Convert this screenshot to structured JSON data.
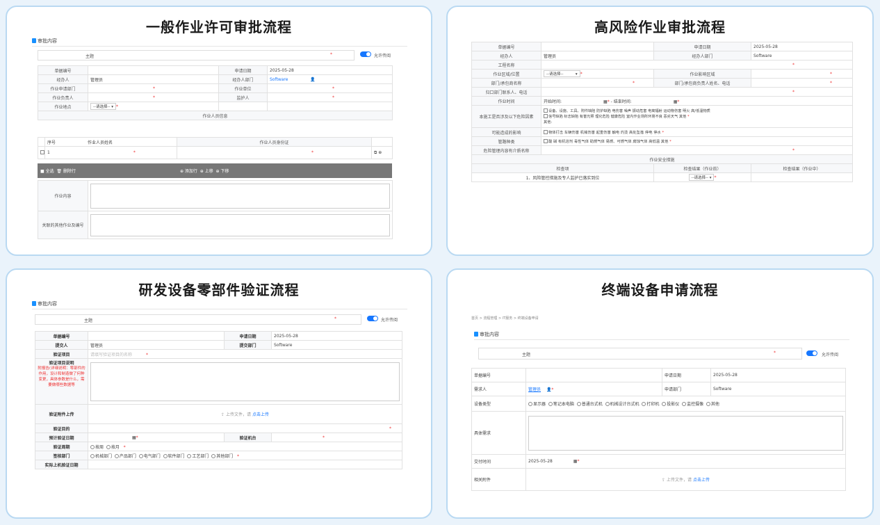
{
  "cards": [
    {
      "title": "一般作业许可审批流程"
    },
    {
      "title": "高风险作业审批流程"
    },
    {
      "title": "研发设备零部件验证流程"
    },
    {
      "title": "终端设备申请流程"
    }
  ],
  "common": {
    "section": "审批内容",
    "subject": "主题",
    "allow_forward": "允许传阅",
    "doc_no": "单据编号",
    "apply_date_label": "申请日期",
    "apply_date": "2025-05-28",
    "admin": "管理员",
    "dept": "Software",
    "please_select": "--请选择--",
    "asterisk": "*",
    "upload_text": "上传文件，请",
    "upload_link": "点击上传"
  },
  "c1": {
    "handler": "经办人",
    "handler_dept": "经办人部门",
    "apply_dept": "作业申请部门",
    "work_unit": "作业单位",
    "leader": "作业负责人",
    "guardian": "监护人",
    "location": "作业地点",
    "workers_info": "作业人员信息",
    "col_no": "序号",
    "col_name": "作业人员姓名",
    "col_id": "作业人员身份证",
    "row1": "1",
    "select_all": "全选",
    "delete_row": "删除行",
    "add_row": "添加行",
    "move_up": "上移",
    "move_down": "下移",
    "content": "作业内容",
    "related": "关联的其他作业及编号"
  },
  "c2": {
    "handler": "经办人",
    "handler_dept": "经办人部门",
    "project": "工程名称",
    "area": "作业区域/位置",
    "impact_area": "作业影响区域",
    "contractor": "部门/承包商名称",
    "contractor_contact": "部门/承包商负责人姓名、电话",
    "manager_contact": "归口部门联系人、电话",
    "work_time": "作业时间",
    "start_time": "开始时间:",
    "end_time": "结束时间:",
    "hazard_label": "本施工是否涉及以下危险因素",
    "hazards_1": "设备、设施、工具、附件缺陷  防护缺陷  电伤害  噪声  振动危害  电离辐射  运动物伤害  明火  高/低温物质",
    "hazards_2": "信号缺陷  标志缺陷  有害光照  理化危险  健康危险  室内作业场所环境不良  恶劣天气  其他",
    "hazards_3": "其他:",
    "effects_label": "可能造成的影响",
    "effects": "物体打击  车辆伤害  机械伤害  起重伤害  触电  灼烫  高处坠落  停电  停水",
    "pipe_label": "管路种类",
    "pipes": "酸  碱  有机溶剂  毒性气体  助燃气体  易燃、可燃气体  腐蚀气体  高低温  其他",
    "danger_mgmt": "危险管理内容有介质名称",
    "safety": "作业安全措施",
    "check_item": "检查项",
    "before": "检查结果（作业前）",
    "during": "检查结果（作业中）",
    "item1": "1、风险管控措施及专人监护已落实到位"
  },
  "c3": {
    "submitter": "提交人",
    "submit_dept": "提交部门",
    "verify_item": "验证项目",
    "verify_item_ph": "请填写验证项目的名称",
    "verify_desc": "验证项目说明",
    "verify_desc_note": "附报告(详细说明：零部件的作用，设计和制造做了何种变更，具体参数是什么，需要做哪些数据等",
    "attach": "验证附件上传",
    "purpose": "验证目的",
    "plan_date": "预计验证日期",
    "machine": "验证机台",
    "cycle": "验证周期",
    "cycle_opts": [
      "按周",
      "按月"
    ],
    "sign_dept": "签核部门",
    "sign_opts": [
      "机械部门",
      "产品部门",
      "电气部门",
      "软件部门",
      "工艺部门",
      "其他部门"
    ],
    "actual_date": "实际上机验证日期"
  },
  "c4": {
    "breadcrumb": "首页 > 流程管理 > IT服务 > 终端设备申请",
    "requester": "需求人",
    "apply_dept_label": "申请部门",
    "device_type": "设备类型",
    "device_opts": [
      "显示器",
      "笔记本电脑",
      "普通台式机",
      "机械设计台式机",
      "打印机",
      "投影仪",
      "监控摄像",
      "其他"
    ],
    "detail": "具体需求",
    "delivery": "交付时间",
    "delivery_date": "2025-05-28",
    "attach": "相关附件"
  }
}
